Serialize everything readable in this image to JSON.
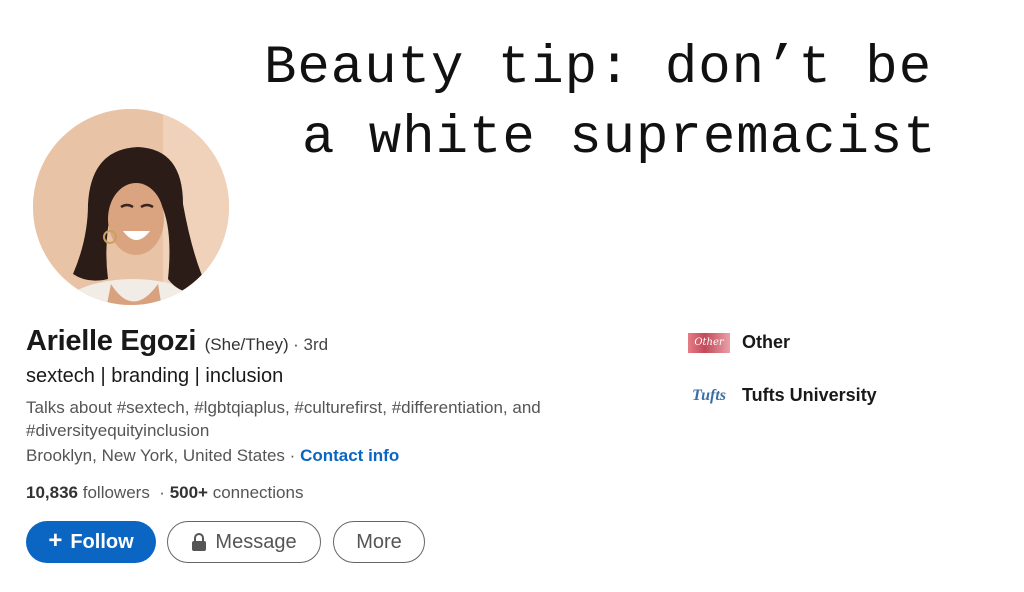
{
  "banner": {
    "line1": "Beauty tip: don’t be",
    "line2": "a white supremacist"
  },
  "profile": {
    "name": "Arielle Egozi",
    "pronouns": "(She/They)",
    "degree": "· 3rd",
    "headline": "sextech | branding | inclusion",
    "about": "Talks about #sextech, #lgbtqiaplus, #culturefirst, #differentiation, and #diversityequityinclusion",
    "location": "Brooklyn, New York, United States",
    "location_separator": "·",
    "contact_label": "Contact info",
    "followers_count": "10,836",
    "followers_label": "followers",
    "connections_sep": "·",
    "connections_count": "500+",
    "connections_label": "connections"
  },
  "actions": {
    "follow_icon": "+",
    "follow_label": "Follow",
    "message_label": "Message",
    "more_label": "More"
  },
  "sidebar": {
    "items": [
      {
        "logo_text": "Other",
        "label": "Other",
        "icon": "other-logo-icon"
      },
      {
        "logo_text": "Tufts",
        "label": "Tufts University",
        "icon": "tufts-logo-icon"
      }
    ]
  },
  "colors": {
    "accent": "#0a66c2",
    "text_primary": "#191919",
    "text_secondary": "#555555"
  }
}
